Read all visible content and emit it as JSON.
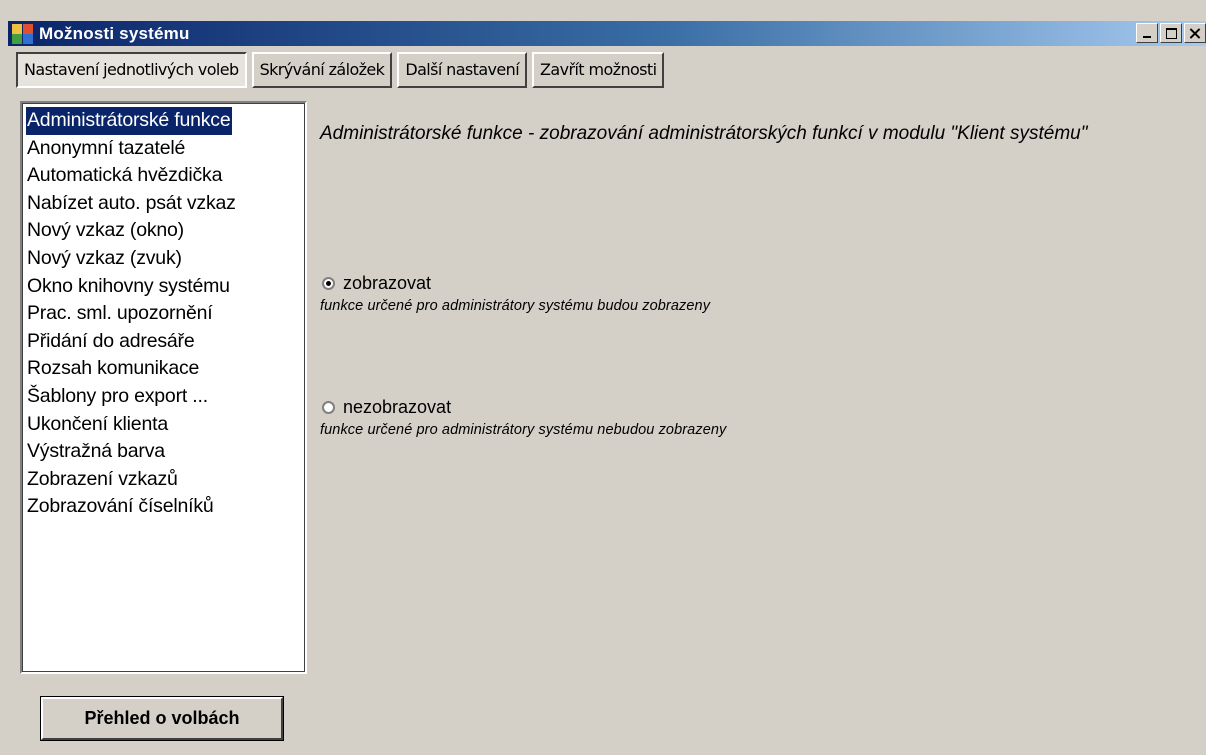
{
  "window": {
    "title": "Možnosti systému",
    "icon": "app-blocks-icon"
  },
  "tabs": [
    {
      "label": "Nastavení jednotlivých voleb",
      "active": true
    },
    {
      "label": "Skrývání záložek",
      "active": false
    },
    {
      "label": "Další nastavení",
      "active": false
    },
    {
      "label": "Zavřít možnosti",
      "active": false
    }
  ],
  "options_list": {
    "selected_index": 0,
    "items": [
      "Administrátorské funkce",
      "Anonymní tazatelé",
      "Automatická hvězdička",
      "Nabízet auto. psát vzkaz",
      "Nový vzkaz (okno)",
      "Nový vzkaz (zvuk)",
      "Okno knihovny systému",
      "Prac. sml. upozornění",
      "Přidání do adresáře",
      "Rozsah komunikace",
      "Šablony pro export ...",
      "Ukončení klienta",
      "Výstražná barva",
      "Zobrazení vzkazů",
      "Zobrazování číselníků"
    ]
  },
  "detail": {
    "description": "Administrátorské funkce - zobrazování administrátorských funkcí v modulu \"Klient systému\"",
    "radio_options": [
      {
        "label": "zobrazovat",
        "note": "funkce určené pro administrátory systému budou zobrazeny",
        "checked": true
      },
      {
        "label": "nezobrazovat",
        "note": "funkce určené pro administrátory systému nebudou zobrazeny",
        "checked": false
      }
    ]
  },
  "footer": {
    "overview_button": "Přehled o volbách"
  }
}
